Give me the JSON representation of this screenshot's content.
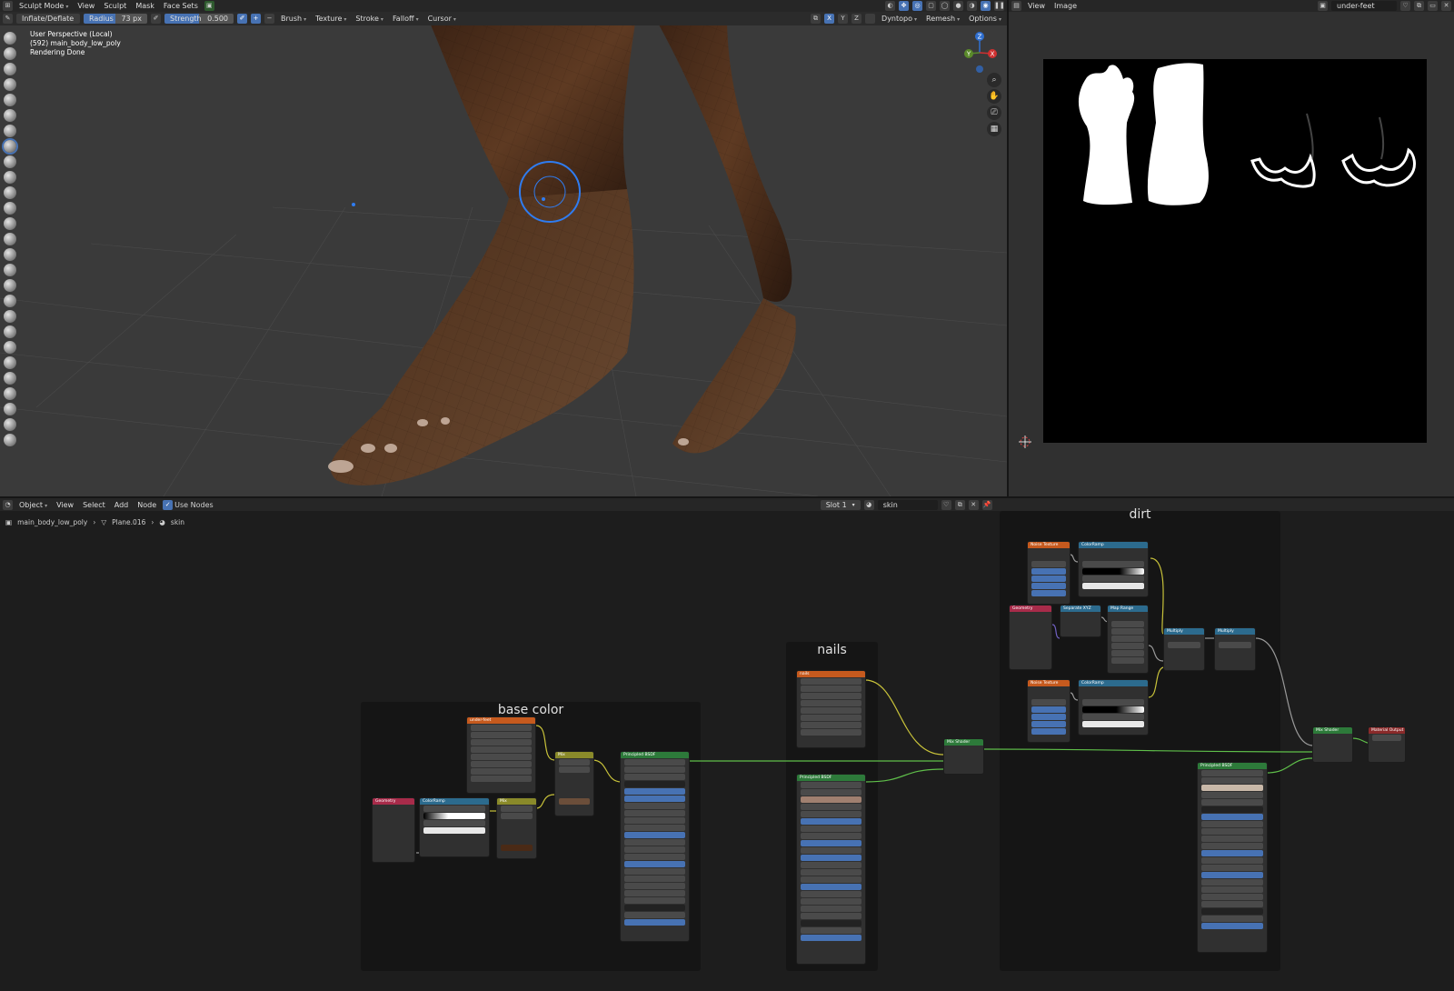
{
  "viewport": {
    "mode_label": "Sculpt Mode",
    "menus": [
      "View",
      "Sculpt",
      "Mask",
      "Face Sets"
    ],
    "brush_name": "Inflate/Deflate",
    "radius_label": "Radius",
    "radius_value": "73 px",
    "strength_label": "Strength",
    "strength_value": "0.500",
    "tool_menus": [
      "Brush",
      "Texture",
      "Stroke",
      "Falloff",
      "Cursor"
    ],
    "axes": [
      "X",
      "Y",
      "Z"
    ],
    "right_menus": [
      "Dyntopo",
      "Remesh",
      "Options"
    ],
    "overlay": {
      "line1": "User Perspective (Local)",
      "line2": "(592) main_body_low_poly",
      "line3": "Rendering Done"
    },
    "gizmo_axes": [
      "Z",
      "Y",
      "X"
    ],
    "tool_count": 27,
    "active_tool_index": 7
  },
  "image_editor": {
    "menus": [
      "View",
      "Image"
    ],
    "image_name": "under-feet"
  },
  "node_editor": {
    "context": "Object",
    "menus": [
      "View",
      "Select",
      "Add",
      "Node"
    ],
    "use_nodes_label": "Use Nodes",
    "use_nodes": true,
    "slot": "Slot 1",
    "material": "skin",
    "breadcrumb": [
      "main_body_low_poly",
      "Plane.016",
      "skin"
    ],
    "frames": {
      "base_color": "base color",
      "nails": "nails",
      "dirt": "dirt"
    },
    "nodes": {
      "under_feet": "under-feet",
      "geometry": "Geometry",
      "colorramp": "ColorRamp",
      "mix": "Mix",
      "principled": "Principled BSDF",
      "nails_tex": "nails",
      "mix_shader": "Mix Shader",
      "noise_texture": "Noise Texture",
      "separate_xyz": "Separate XYZ",
      "map_range": "Map Range",
      "multiply": "Multiply",
      "material_output": "Material Output"
    },
    "colors": {
      "texture_header": "#c65a1e",
      "input_header": "#a82b4a",
      "converter_header": "#2c6b8e",
      "mix_header": "#8a8a2a",
      "shader_header": "#2d7a3a",
      "output_header": "#8a2a2a",
      "wire_yellow": "#c8c23a",
      "wire_green": "#5fbf4a",
      "wire_grey": "#9a9a9a",
      "wire_purple": "#7060c0"
    }
  }
}
